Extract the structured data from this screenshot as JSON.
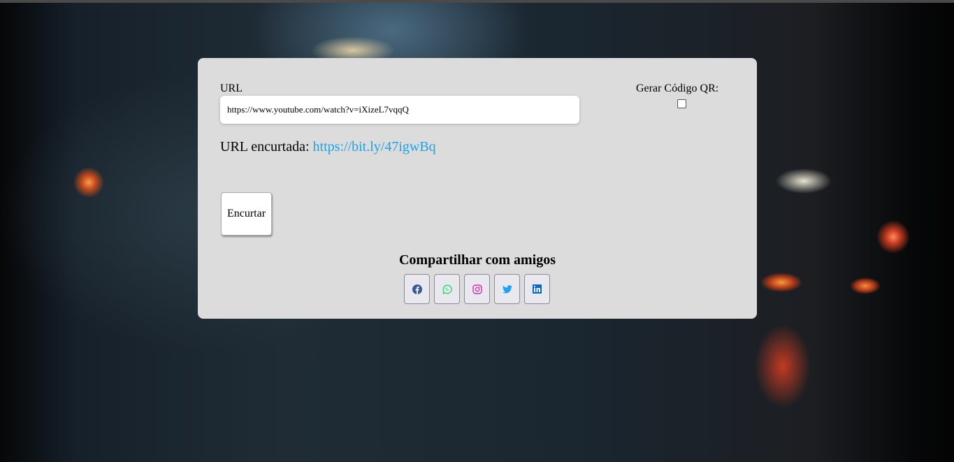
{
  "form": {
    "url_label": "URL",
    "url_value": "https://www.youtube.com/watch?v=iXizeL7vqqQ",
    "qr_label": "Gerar Código QR:",
    "qr_checked": false,
    "short_label": "URL encurtada:",
    "short_url": "https://bit.ly/47igwBq",
    "submit_label": "Encurtar"
  },
  "share": {
    "title": "Compartilhar com amigos",
    "icons": [
      "facebook-icon",
      "whatsapp-icon",
      "instagram-icon",
      "twitter-icon",
      "linkedin-icon"
    ]
  },
  "colors": {
    "link": "#1aa3e8",
    "facebook": "#3b5998",
    "whatsapp": "#25d366",
    "instagram": "#d42fb0",
    "twitter": "#1da1f2",
    "linkedin": "#0a66c2"
  }
}
